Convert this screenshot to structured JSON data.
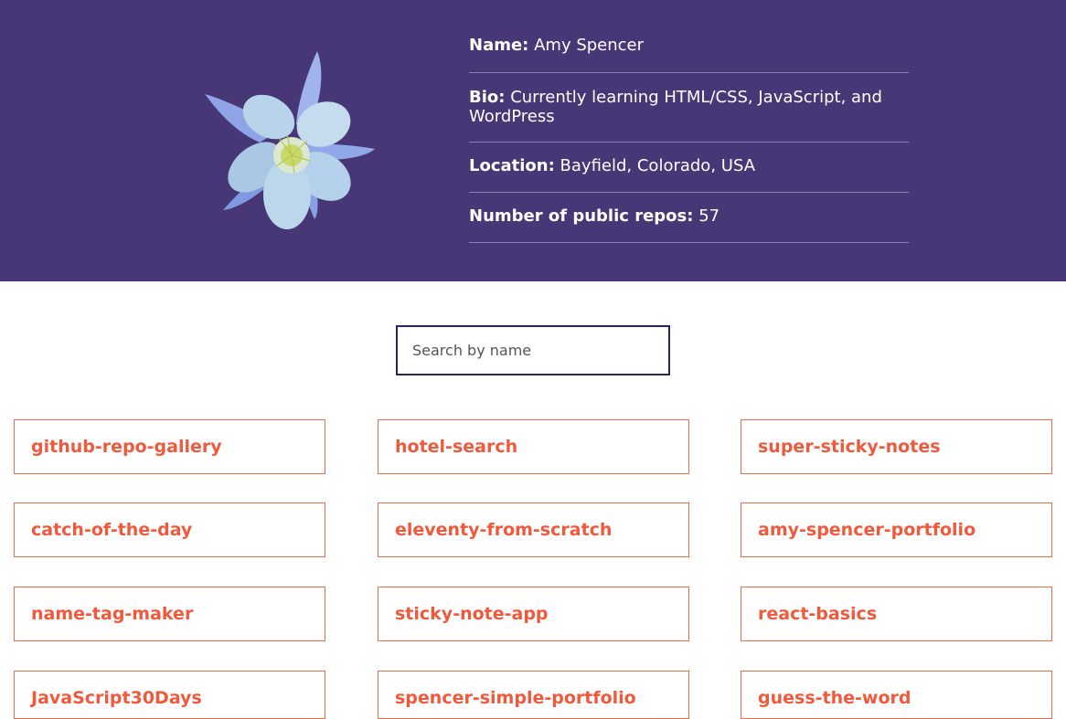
{
  "profile": {
    "avatar_icon": "columbine-flower-avatar",
    "name_label": "Name:",
    "name_value": "Amy Spencer",
    "bio_label": "Bio:",
    "bio_value": "Currently learning HTML/CSS, JavaScript, and WordPress",
    "location_label": "Location:",
    "location_value": "Bayfield, Colorado, USA",
    "repos_label": "Number of public repos:",
    "repos_value": "57"
  },
  "search": {
    "placeholder": "Search by name"
  },
  "repos": [
    "github-repo-gallery",
    "hotel-search",
    "super-sticky-notes",
    "catch-of-the-day",
    "eleventy-from-scratch",
    "amy-spencer-portfolio",
    "name-tag-maker",
    "sticky-note-app",
    "react-basics",
    "JavaScript30Days",
    "spencer-simple-portfolio",
    "guess-the-word"
  ],
  "colors": {
    "header_bg": "#473776",
    "repo_accent": "#f0593b",
    "search_border": "#2d2459"
  }
}
